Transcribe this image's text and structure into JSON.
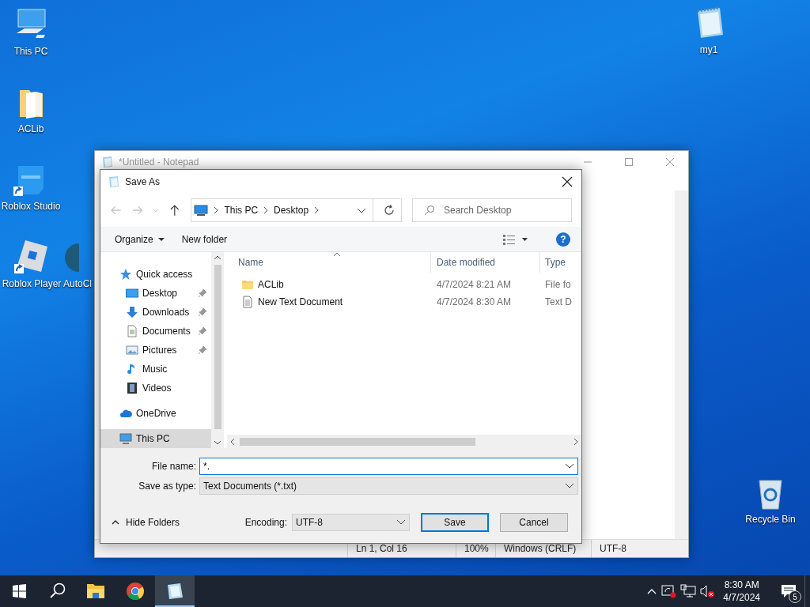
{
  "desktop_icons": [
    {
      "label": "This PC",
      "kind": "pc",
      "shortcut": false
    },
    {
      "label": "ACLib",
      "kind": "folder",
      "shortcut": false
    },
    {
      "label": "Roblox Studio",
      "kind": "studio",
      "shortcut": true
    },
    {
      "label": "Roblox Player",
      "kind": "player",
      "shortcut": true
    },
    {
      "label": "AutoCl",
      "kind": "app",
      "shortcut": false
    },
    {
      "label": "my1",
      "kind": "notepad",
      "shortcut": false
    },
    {
      "label": "Recycle Bin",
      "kind": "recycle",
      "shortcut": false
    }
  ],
  "notepad": {
    "title": "*Untitled - Notepad",
    "status_bar": [
      "Ln 1, Col 16",
      "100%",
      "Windows (CRLF)",
      "UTF-8"
    ]
  },
  "save_as": {
    "title": "Save As",
    "breadcrumb": [
      "This PC",
      "Desktop"
    ],
    "search": {
      "placeholder": "Search Desktop"
    },
    "toolbar": {
      "organize": "Organize",
      "new_folder": "New folder",
      "help": "?"
    },
    "nav": [
      {
        "label": "Quick access",
        "kind": "star",
        "selected": false,
        "children": [
          {
            "label": "Desktop",
            "kind": "desktop",
            "selected": false,
            "pinned": true
          },
          {
            "label": "Downloads",
            "kind": "download",
            "selected": false,
            "pinned": true
          },
          {
            "label": "Documents",
            "kind": "documents",
            "selected": false,
            "pinned": true
          },
          {
            "label": "Pictures",
            "kind": "pictures",
            "selected": false,
            "pinned": true
          },
          {
            "label": "Music",
            "kind": "music",
            "selected": false,
            "pinned": false
          },
          {
            "label": "Videos",
            "kind": "videos",
            "selected": false,
            "pinned": false
          }
        ]
      },
      {
        "label": "OneDrive",
        "kind": "cloud",
        "selected": false
      },
      {
        "label": "This PC",
        "kind": "pc",
        "selected": true
      }
    ],
    "columns": [
      "Name",
      "Date modified",
      "Type"
    ],
    "files": [
      {
        "name": "ACLib",
        "date": "4/7/2024 8:21 AM",
        "type": "File fo",
        "kind": "folder"
      },
      {
        "name": "New Text Document",
        "date": "4/7/2024 8:30 AM",
        "type": "Text D",
        "kind": "text"
      }
    ],
    "file_name": {
      "label": "File name:",
      "value": "*."
    },
    "save_as_type": {
      "label": "Save as type:",
      "value": "Text Documents (*.txt)"
    },
    "encoding": {
      "label": "Encoding:",
      "value": "UTF-8"
    },
    "buttons": [
      "Save",
      "Cancel"
    ],
    "hide_folders": "Hide Folders"
  },
  "taskbar": {
    "apps": [
      {
        "kind": "explorer",
        "active": false
      },
      {
        "kind": "chrome",
        "active": false
      },
      {
        "kind": "notepad",
        "active": true
      }
    ],
    "time": "8:30 AM",
    "date": "4/7/2024",
    "notifications": "5"
  }
}
